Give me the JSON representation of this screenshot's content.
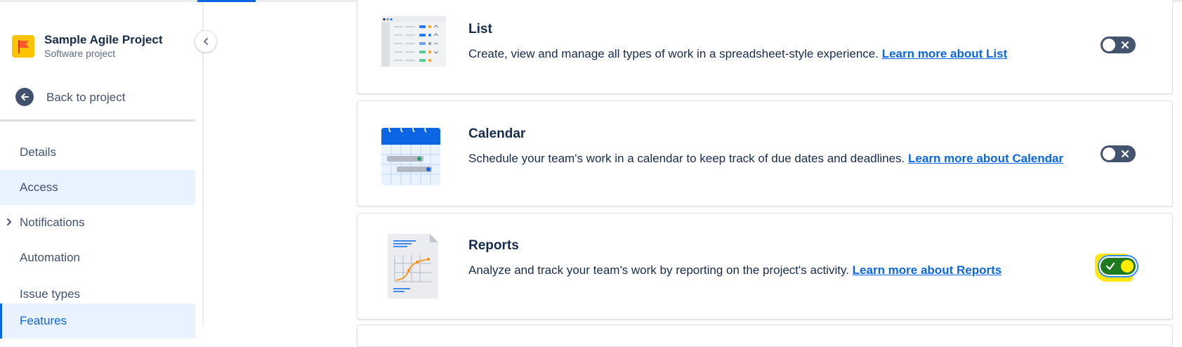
{
  "sidebar": {
    "project_name": "Sample Agile Project",
    "project_type": "Software project",
    "back_label": "Back to project",
    "items": [
      {
        "label": "Details"
      },
      {
        "label": "Access"
      },
      {
        "label": "Notifications"
      },
      {
        "label": "Automation"
      },
      {
        "label": "Issue types"
      },
      {
        "label": "Features"
      }
    ]
  },
  "features": [
    {
      "title": "List",
      "description": "Create, view and manage all types of work in a spreadsheet-style experience.",
      "link": "Learn more about List",
      "enabled": false
    },
    {
      "title": "Calendar",
      "description": "Schedule your team's work in a calendar to keep track of due dates and deadlines.",
      "link": "Learn more about Calendar",
      "enabled": false
    },
    {
      "title": "Reports",
      "description": "Analyze and track your team's work by reporting on the project's activity.",
      "link": "Learn more about Reports",
      "enabled": true
    }
  ],
  "colors": {
    "accent": "#0c66e4",
    "selected_bg": "#e9f2ff",
    "toggle_off": "#44546f",
    "toggle_on": "#1f7a1f",
    "highlight": "#ffe500"
  },
  "icons": {
    "collapse": "chevron-left-icon",
    "back": "arrow-left-icon",
    "expand": "chevron-right-icon",
    "toggle_off": "close-icon",
    "toggle_on": "check-icon"
  }
}
